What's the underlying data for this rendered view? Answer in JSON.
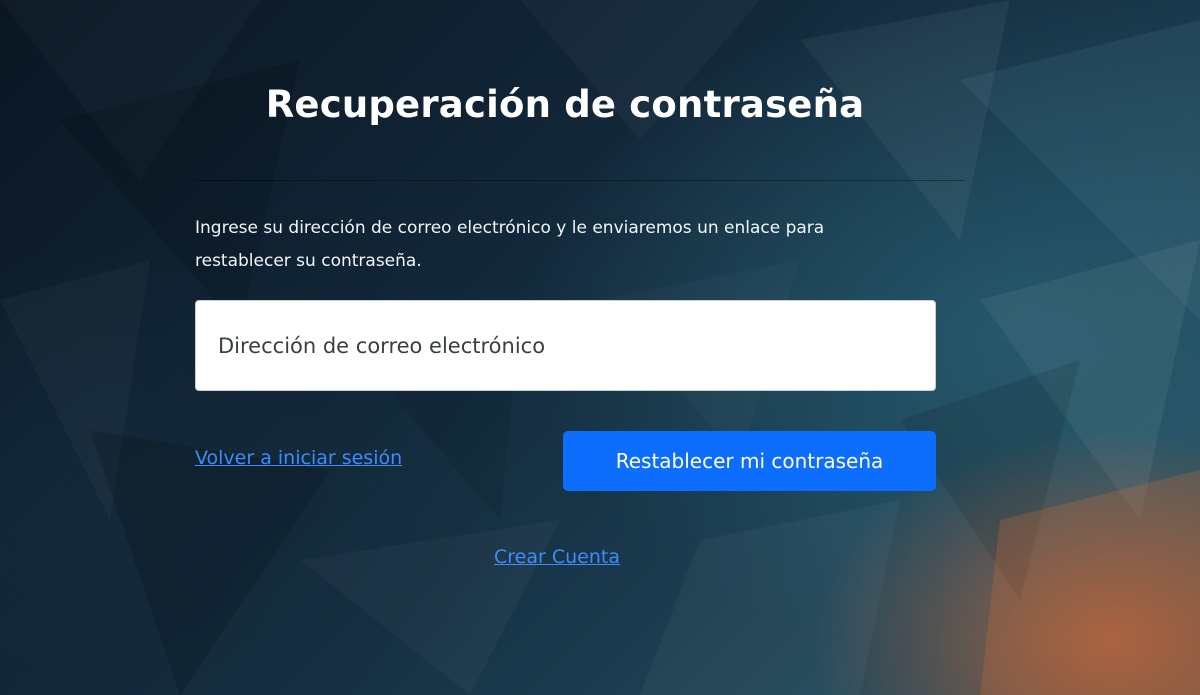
{
  "page": {
    "title": "Recuperación de contraseña",
    "description": "Ingrese su dirección de correo electrónico y le enviaremos un enlace para restablecer su contraseña."
  },
  "form": {
    "email": {
      "value": "",
      "placeholder": "Dirección de correo electrónico"
    },
    "back_to_login_label": "Volver a iniciar sesión",
    "submit_label": "Restablecer mi contraseña"
  },
  "footer": {
    "create_account_label": "Crear Cuenta"
  },
  "colors": {
    "primary": "#0d6efd",
    "link": "#3d8bfd",
    "background_dark": "#0b1622",
    "background_accent": "#c4663a"
  }
}
